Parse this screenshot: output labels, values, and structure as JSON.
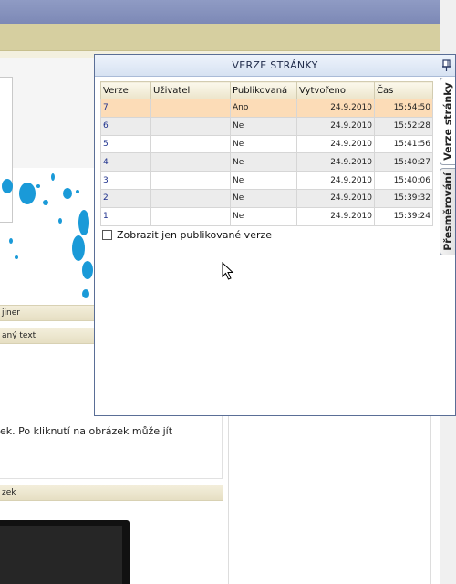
{
  "background": {
    "header_jiner": "jiner",
    "header_any_text": "aný text",
    "body_text": "ek. Po kliknutí na obrázek může jít",
    "header_zek": "zek"
  },
  "panel": {
    "title": "VERZE STRÁNKY",
    "tabs": [
      {
        "label": "Verze stránky",
        "active": true
      },
      {
        "label": "Přesměrování",
        "active": false
      }
    ],
    "columns": [
      "Verze",
      "Uživatel",
      "Publikovaná",
      "Vytvořeno",
      "Čas"
    ],
    "rows": [
      {
        "verze": "7",
        "uzivatel": "",
        "publikovana": "Ano",
        "vytvoreno": "24.9.2010",
        "cas": "15:54:50",
        "selected": true
      },
      {
        "verze": "6",
        "uzivatel": "",
        "publikovana": "Ne",
        "vytvoreno": "24.9.2010",
        "cas": "15:52:28"
      },
      {
        "verze": "5",
        "uzivatel": "",
        "publikovana": "Ne",
        "vytvoreno": "24.9.2010",
        "cas": "15:41:56"
      },
      {
        "verze": "4",
        "uzivatel": "",
        "publikovana": "Ne",
        "vytvoreno": "24.9.2010",
        "cas": "15:40:27"
      },
      {
        "verze": "3",
        "uzivatel": "",
        "publikovana": "Ne",
        "vytvoreno": "24.9.2010",
        "cas": "15:40:06"
      },
      {
        "verze": "2",
        "uzivatel": "",
        "publikovana": "Ne",
        "vytvoreno": "24.9.2010",
        "cas": "15:39:32"
      },
      {
        "verze": "1",
        "uzivatel": "",
        "publikovana": "Ne",
        "vytvoreno": "24.9.2010",
        "cas": "15:39:24"
      }
    ],
    "checkbox_label": "Zobrazit jen publikované verze",
    "checkbox_checked": false
  },
  "icons": {
    "pin": "pin-icon",
    "cursor": "mouse-cursor-icon"
  }
}
